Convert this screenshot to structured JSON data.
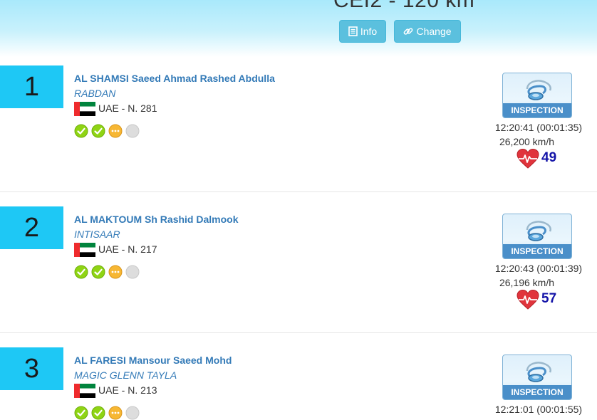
{
  "header": {
    "title": "CEI2 - 120 km",
    "info_label": "Info",
    "change_label": "Change"
  },
  "colors": {
    "rank_bg": "#1ec8f5",
    "link": "#337ab7",
    "button": "#5bc0de",
    "heart_rate": "#1414a8",
    "check_green": "#8fd414",
    "pending_orange": "#f7b733",
    "empty_grey": "#dddddd"
  },
  "entries": [
    {
      "rank": "1",
      "rider": "AL SHAMSI Saeed Ahmad Rashed Abdulla",
      "horse": "RABDAN",
      "country": "UAE - N. 281",
      "status_icons": [
        "check-icon",
        "check-icon",
        "pending-icon",
        "empty-icon"
      ],
      "inspection_label": "INSPECTION",
      "time": "12:20:41 (00:01:35)",
      "speed": "26,200 km/h",
      "heart_rate": "49"
    },
    {
      "rank": "2",
      "rider": "AL MAKTOUM Sh Rashid Dalmook",
      "horse": "INTISAAR",
      "country": "UAE - N. 217",
      "status_icons": [
        "check-icon",
        "check-icon",
        "pending-icon",
        "empty-icon"
      ],
      "inspection_label": "INSPECTION",
      "time": "12:20:43 (00:01:39)",
      "speed": "26,196 km/h",
      "heart_rate": "57"
    },
    {
      "rank": "3",
      "rider": "AL FARESI Mansour Saeed Mohd",
      "horse": "MAGIC GLENN TAYLA",
      "country": "UAE - N. 213",
      "status_icons": [
        "check-icon",
        "check-icon",
        "pending-icon",
        "empty-icon"
      ],
      "inspection_label": "INSPECTION",
      "time": "12:21:01 (00:01:55)"
    }
  ]
}
